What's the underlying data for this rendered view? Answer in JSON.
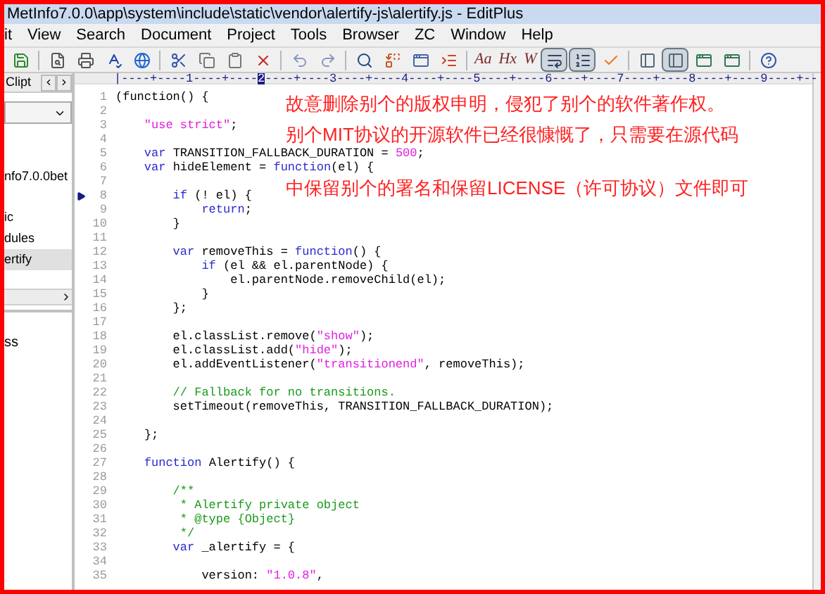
{
  "window": {
    "title": "MetInfo7.0.0\\app\\system\\include\\static\\vendor\\alertify-js\\alertify.js - EditPlus"
  },
  "menu": [
    "it",
    "View",
    "Search",
    "Document",
    "Project",
    "Tools",
    "Browser",
    "ZC",
    "Window",
    "Help"
  ],
  "toolbar": [
    {
      "kind": "icon"
    },
    {
      "kind": "sep"
    },
    {
      "kind": "icon"
    },
    {
      "kind": "icon"
    },
    {
      "kind": "icon"
    },
    {
      "kind": "icon"
    },
    {
      "kind": "sep"
    },
    {
      "kind": "icon"
    },
    {
      "kind": "icon"
    },
    {
      "kind": "icon"
    },
    {
      "kind": "icon"
    },
    {
      "kind": "sep"
    },
    {
      "kind": "icon"
    },
    {
      "kind": "icon"
    },
    {
      "kind": "sep"
    },
    {
      "kind": "icon"
    },
    {
      "kind": "icon"
    },
    {
      "kind": "icon"
    },
    {
      "kind": "icon"
    },
    {
      "kind": "sep"
    },
    {
      "kind": "text",
      "label": "Aa"
    },
    {
      "kind": "text",
      "label": "Hx"
    },
    {
      "kind": "text",
      "label": "W"
    },
    {
      "kind": "toggle",
      "on": true
    },
    {
      "kind": "toggle",
      "on": true
    },
    {
      "kind": "icon"
    },
    {
      "kind": "sep"
    },
    {
      "kind": "icon"
    },
    {
      "kind": "toggle",
      "on": true
    },
    {
      "kind": "icon"
    },
    {
      "kind": "icon"
    },
    {
      "kind": "sep"
    },
    {
      "kind": "icon"
    }
  ],
  "sidebar": {
    "tab": "Clipt",
    "items": [
      {
        "label": "nfo7.0.0bet",
        "selected": false
      },
      {
        "label": "ic",
        "selected": false
      },
      {
        "label": "dules",
        "selected": false
      },
      {
        "label": "ertify",
        "selected": true
      }
    ],
    "lower_items": [
      "ss"
    ]
  },
  "ruler": {
    "before": "|----+----1----+----",
    "cursor": "2",
    "after": "----+----3----+----4----+----5----+----6----+----7----+----8----+----9----+--"
  },
  "code_lines": [
    {
      "number": "1",
      "tokens": [
        {
          "kind": "plain",
          "text": "(function() {"
        }
      ]
    },
    {
      "number": "2"
    },
    {
      "number": "3",
      "tokens": [
        {
          "kind": "string",
          "text": "    \"use strict\""
        },
        {
          "kind": "plain",
          "text": ";"
        }
      ]
    },
    {
      "number": "4"
    },
    {
      "number": "5",
      "tokens": [
        {
          "kind": "keyword",
          "text": "    var"
        },
        {
          "kind": "plain",
          "text": " TRANSITION_FALLBACK_DURATION = "
        },
        {
          "kind": "string",
          "text": "500"
        },
        {
          "kind": "plain",
          "text": ";"
        }
      ]
    },
    {
      "number": "6",
      "tokens": [
        {
          "kind": "keyword",
          "text": "    var"
        },
        {
          "kind": "plain",
          "text": " hideElement = "
        },
        {
          "kind": "keyword",
          "text": "function"
        },
        {
          "kind": "plain",
          "text": "(el) {"
        }
      ]
    },
    {
      "number": "7"
    },
    {
      "number": "8",
      "bookmark": true,
      "tokens": [
        {
          "kind": "keyword",
          "text": "        if"
        },
        {
          "kind": "plain",
          "text": " (! el) {"
        }
      ]
    },
    {
      "number": "9",
      "tokens": [
        {
          "kind": "keyword",
          "text": "            return"
        },
        {
          "kind": "plain",
          "text": ";"
        }
      ]
    },
    {
      "number": "10",
      "tokens": [
        {
          "kind": "plain",
          "text": "        }"
        }
      ]
    },
    {
      "number": "11"
    },
    {
      "number": "12",
      "tokens": [
        {
          "kind": "keyword",
          "text": "        var"
        },
        {
          "kind": "plain",
          "text": " removeThis = "
        },
        {
          "kind": "keyword",
          "text": "function"
        },
        {
          "kind": "plain",
          "text": "() {"
        }
      ]
    },
    {
      "number": "13",
      "tokens": [
        {
          "kind": "keyword",
          "text": "            if"
        },
        {
          "kind": "plain",
          "text": " (el && el.parentNode) {"
        }
      ]
    },
    {
      "number": "14",
      "tokens": [
        {
          "kind": "plain",
          "text": "                el.parentNode.removeChild(el);"
        }
      ]
    },
    {
      "number": "15",
      "tokens": [
        {
          "kind": "plain",
          "text": "            }"
        }
      ]
    },
    {
      "number": "16",
      "tokens": [
        {
          "kind": "plain",
          "text": "        };"
        }
      ]
    },
    {
      "number": "17"
    },
    {
      "number": "18",
      "tokens": [
        {
          "kind": "plain",
          "text": "        el.classList.remove("
        },
        {
          "kind": "string",
          "text": "\"show\""
        },
        {
          "kind": "plain",
          "text": ");"
        }
      ]
    },
    {
      "number": "19",
      "tokens": [
        {
          "kind": "plain",
          "text": "        el.classList.add("
        },
        {
          "kind": "string",
          "text": "\"hide\""
        },
        {
          "kind": "plain",
          "text": ");"
        }
      ]
    },
    {
      "number": "20",
      "tokens": [
        {
          "kind": "plain",
          "text": "        el.addEventListener("
        },
        {
          "kind": "string",
          "text": "\"transitionend\""
        },
        {
          "kind": "plain",
          "text": ", removeThis);"
        }
      ]
    },
    {
      "number": "21"
    },
    {
      "number": "22",
      "tokens": [
        {
          "kind": "comment",
          "text": "        // Fallback for no transitions."
        }
      ]
    },
    {
      "number": "23",
      "tokens": [
        {
          "kind": "plain",
          "text": "        setTimeout(removeThis, TRANSITION_FALLBACK_DURATION);"
        }
      ]
    },
    {
      "number": "24"
    },
    {
      "number": "25",
      "tokens": [
        {
          "kind": "plain",
          "text": "    };"
        }
      ]
    },
    {
      "number": "26"
    },
    {
      "number": "27",
      "tokens": [
        {
          "kind": "keyword",
          "text": "    function"
        },
        {
          "kind": "plain",
          "text": " Alertify() {"
        }
      ]
    },
    {
      "number": "28"
    },
    {
      "number": "29",
      "tokens": [
        {
          "kind": "comment",
          "text": "        /**"
        }
      ]
    },
    {
      "number": "30",
      "tokens": [
        {
          "kind": "comment",
          "text": "         * Alertify private object"
        }
      ]
    },
    {
      "number": "31",
      "tokens": [
        {
          "kind": "comment",
          "text": "         * @type {Object}"
        }
      ]
    },
    {
      "number": "32",
      "tokens": [
        {
          "kind": "comment",
          "text": "         */"
        }
      ]
    },
    {
      "number": "33",
      "tokens": [
        {
          "kind": "keyword",
          "text": "        var"
        },
        {
          "kind": "plain",
          "text": " _alertify = {"
        }
      ]
    },
    {
      "number": "34"
    },
    {
      "number": "35",
      "tokens": [
        {
          "kind": "plain",
          "text": "            version: "
        },
        {
          "kind": "string",
          "text": "\"1.0.8\""
        },
        {
          "kind": "plain",
          "text": ","
        }
      ]
    }
  ],
  "annotation": [
    "故意删除别个的版权申明，侵犯了别个的软件著作权。",
    "别个MIT协议的开源软件已经很慷慨了，只需要在源代码",
    "中保留别个的署名和保留LICENSE（许可协议）文件即可"
  ]
}
